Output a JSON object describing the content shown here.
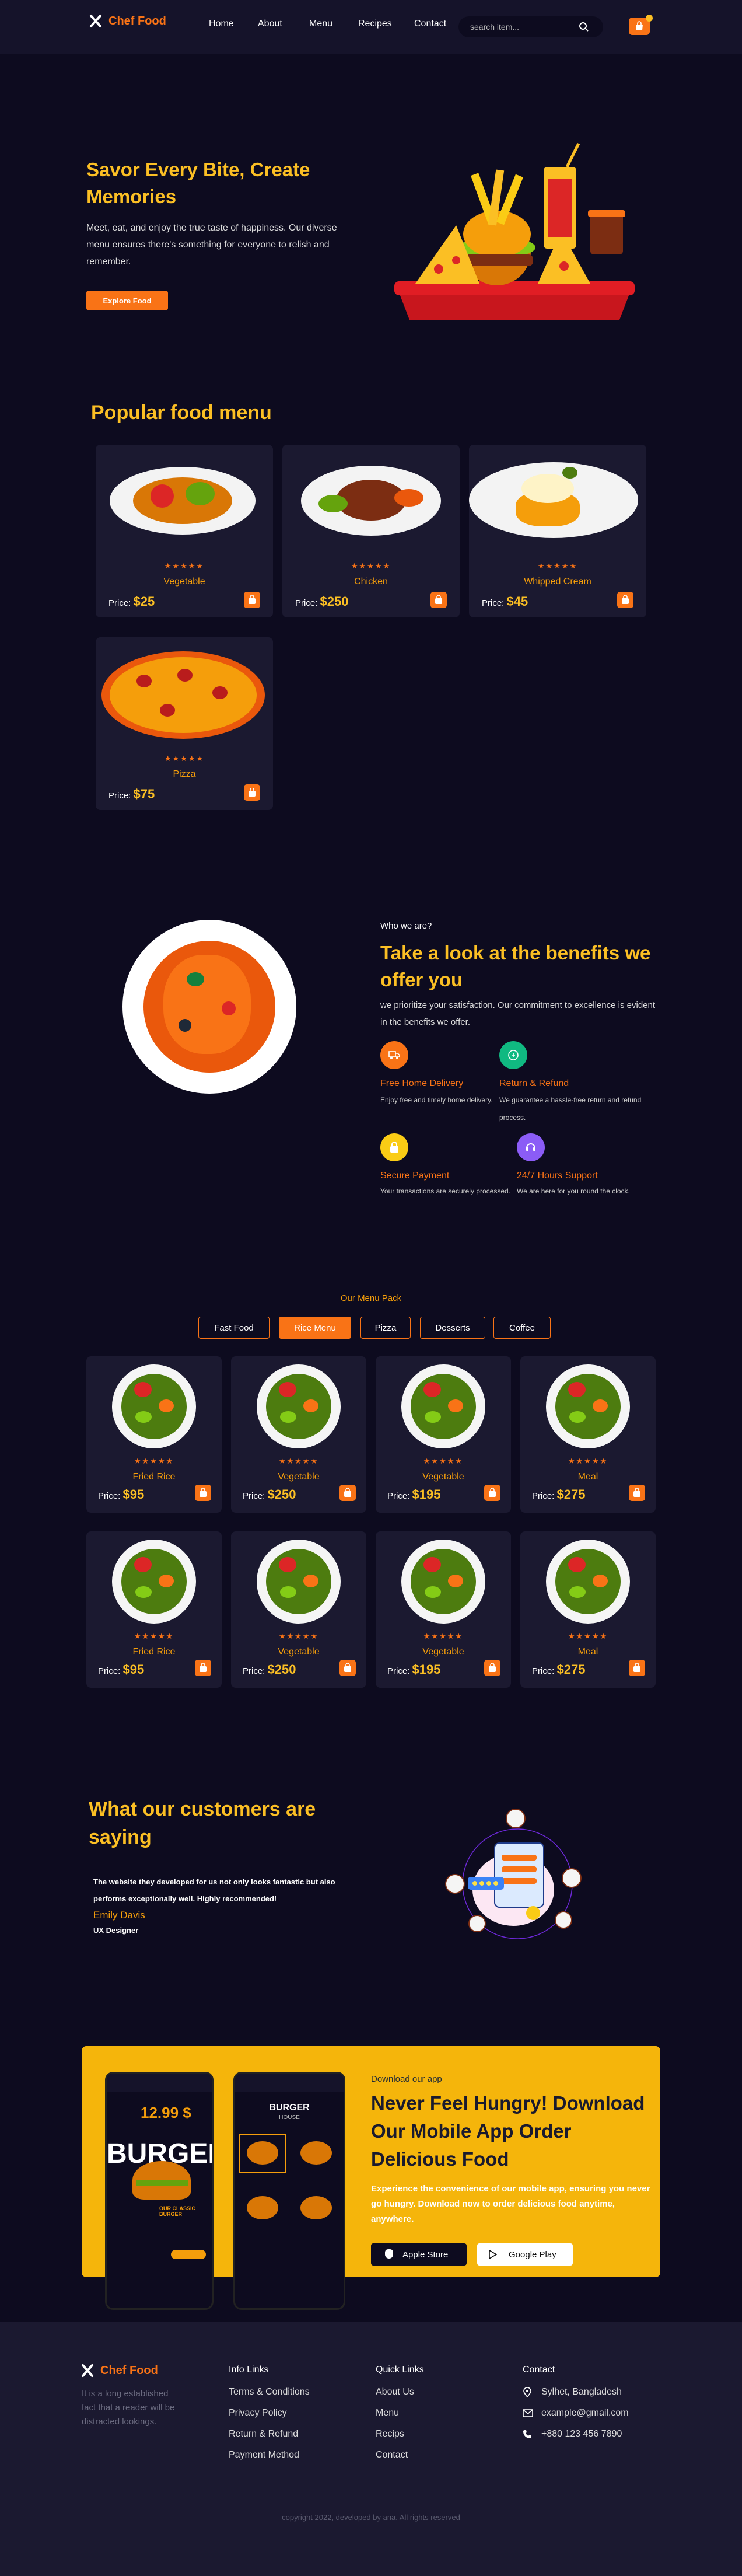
{
  "nav": {
    "brand": "Chef Food",
    "links": [
      "Home",
      "About",
      "Menu",
      "Recipes",
      "Contact"
    ],
    "search_placeholder": "search item..."
  },
  "hero": {
    "title": "Savor Every Bite, Create Memories",
    "subtitle": "Meet, eat, and enjoy the true taste of happiness. Our diverse menu ensures there's something for everyone to relish and remember.",
    "cta": "Explore Food"
  },
  "popular": {
    "title": "Popular food menu",
    "price_label": "Price:",
    "stars": "★★★★★",
    "items": [
      {
        "name": "Vegetable",
        "price": "$25"
      },
      {
        "name": "Chicken",
        "price": "$250"
      },
      {
        "name": "Whipped Cream",
        "price": "$45"
      },
      {
        "name": "Pizza",
        "price": "$75"
      }
    ]
  },
  "benefits": {
    "kicker": "Who we are?",
    "title": "Take a look at the benefits we offer you",
    "subtitle": "we prioritize your satisfaction. Our commitment to excellence is evident in the benefits we offer.",
    "features": [
      {
        "title": "Free Home Delivery",
        "desc": "Enjoy free and timely home delivery.",
        "color": "#f97316",
        "icon": "truck-icon"
      },
      {
        "title": "Return & Refund",
        "desc": "We guarantee a hassle-free return and refund process.",
        "color": "#10b981",
        "icon": "refund-icon"
      },
      {
        "title": "Secure Payment",
        "desc": "Your transactions are securely processed.",
        "color": "#facc15",
        "icon": "lock-icon"
      },
      {
        "title": "24/7 Hours Support",
        "desc": "We are here for you round the clock.",
        "color": "#8b5cf6",
        "icon": "support-icon"
      }
    ]
  },
  "menu_pack": {
    "kicker": "Our Menu Pack",
    "tabs": [
      "Fast Food",
      "Rice Menu",
      "Pizza",
      "Desserts",
      "Coffee"
    ],
    "active_tab": "Rice Menu",
    "price_label": "Price:",
    "stars": "★★★★★",
    "items": [
      {
        "name": "Fried Rice",
        "price": "$95"
      },
      {
        "name": "Vegetable",
        "price": "$250"
      },
      {
        "name": "Vegetable",
        "price": "$195"
      },
      {
        "name": "Meal",
        "price": "$275"
      },
      {
        "name": "Fried Rice",
        "price": "$95"
      },
      {
        "name": "Vegetable",
        "price": "$250"
      },
      {
        "name": "Vegetable",
        "price": "$195"
      },
      {
        "name": "Meal",
        "price": "$275"
      }
    ]
  },
  "testimonial": {
    "title": "What our customers are saying",
    "quote": "The website they developed for us not only looks fantastic but also performs exceptionally well. Highly recommended!",
    "name": "Emily Davis",
    "role": "UX Designer"
  },
  "app": {
    "kicker": "Download our app",
    "title": "Never Feel Hungry! Download Our Mobile App Order Delicious Food",
    "desc": "Experience the convenience of our mobile app, ensuring you never go hungry. Download now to order delicious food anytime, anywhere.",
    "apple": "Apple Store",
    "google": "Google Play",
    "phone1": {
      "price": "12.99 $",
      "word": "BURGER",
      "label": "OUR CLASSIC BURGER"
    },
    "phone2": {
      "word": "BURGER",
      "sub": "HOUSE"
    }
  },
  "footer": {
    "brand": "Chef Food",
    "tagline": "It is a long established fact that a reader will be distracted lookings.",
    "info_title": "Info Links",
    "info_links": [
      "Terms & Conditions",
      "Privacy Policy",
      "Return & Refund",
      "Payment Method"
    ],
    "quick_title": "Quick Links",
    "quick_links": [
      "About Us",
      "Menu",
      "Recips",
      "Contact"
    ],
    "contact_title": "Contact",
    "address": "Sylhet, Bangladesh",
    "email": "example@gmail.com",
    "phone": "+880 123 456 7890",
    "copyright": "copyright 2022, developed by ana. All rights reserved"
  },
  "colors": {
    "accent": "#f97316",
    "gold": "#fbbf24",
    "bg": "#0d0b1f",
    "card": "#1b1930",
    "banner": "#f5b50b"
  }
}
